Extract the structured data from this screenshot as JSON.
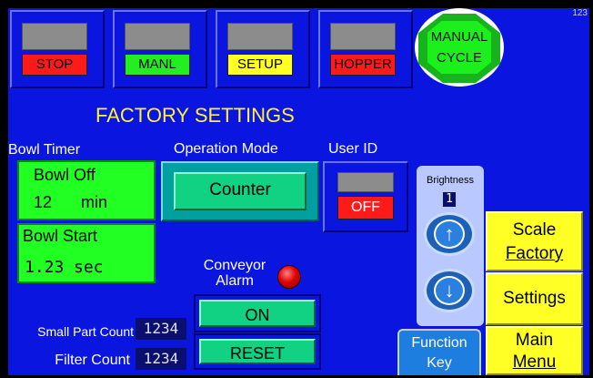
{
  "mode_buttons": [
    {
      "label": "STOP",
      "color": "#ff1a1a"
    },
    {
      "label": "MANL",
      "color": "#22ee22"
    },
    {
      "label": "SETUP",
      "color": "#ffff22"
    },
    {
      "label": "HOPPER",
      "color": "#ff1a1a"
    }
  ],
  "manual_cycle": {
    "line1": "MANUAL",
    "line2": "CYCLE"
  },
  "corner_number": "123",
  "title": "FACTORY SETTINGS",
  "bowl_timer": {
    "label": "Bowl Timer",
    "off_label": "Bowl Off",
    "off_value": "12",
    "off_unit": "min",
    "start_label": "Bowl Start",
    "start_value": "1.23",
    "start_unit": "sec"
  },
  "operation_mode": {
    "label": "Operation Mode",
    "value": "Counter"
  },
  "user_id": {
    "label": "User ID",
    "state": "OFF"
  },
  "brightness": {
    "label": "Brightness",
    "value": "1"
  },
  "conveyor_alarm": {
    "line1": "Conveyor",
    "line2": "Alarm",
    "state": "ON"
  },
  "reset_label": "RESET",
  "small_part_count": {
    "label": "Small Part Count",
    "value": "1234"
  },
  "filter_count": {
    "label": "Filter Count",
    "value": "1234"
  },
  "function_key": {
    "line1": "Function",
    "line2": "Key"
  },
  "scale_factory": {
    "line1": "Scale",
    "line2": "Factory"
  },
  "settings_label": "Settings",
  "main_menu": {
    "line1": "Main",
    "line2": "Menu"
  },
  "colors": {
    "panel": "#0a16e0",
    "green": "#22ff22",
    "teal_button": "#11d283",
    "yellow": "#ffff26",
    "red": "#ff1a1a",
    "title": "#ffef3a"
  }
}
